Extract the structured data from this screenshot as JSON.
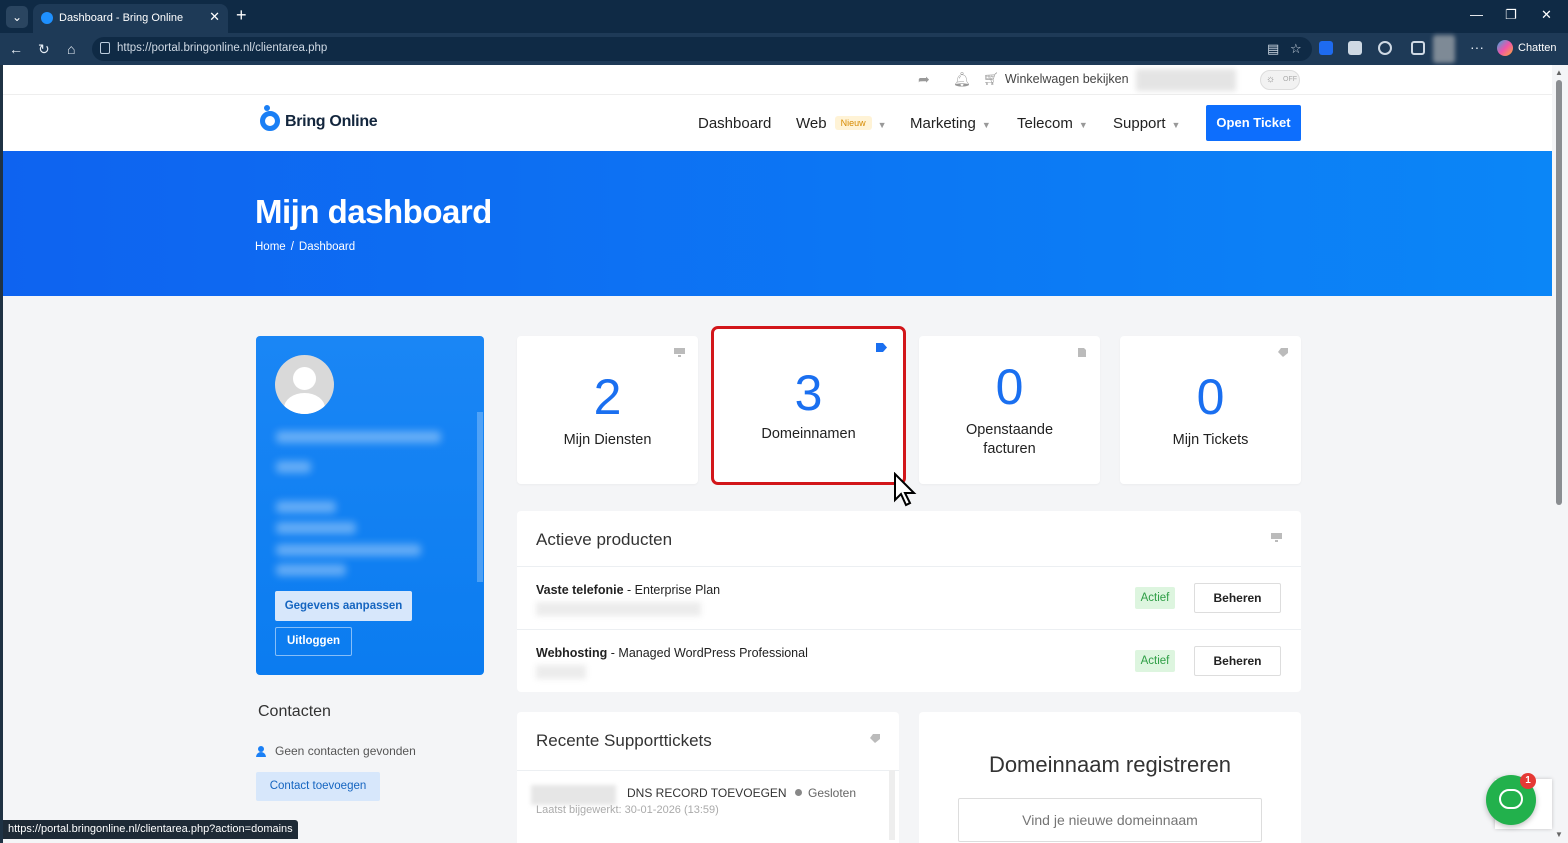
{
  "browser": {
    "tab_title": "Dashboard - Bring Online",
    "url": "https://portal.bringonline.nl/clientarea.php",
    "copilot_label": "Chatten",
    "status_url": "https://portal.bringonline.nl/clientarea.php?action=domains"
  },
  "topbar": {
    "cart_label": "Winkelwagen bekijken",
    "toggle_label": "OFF"
  },
  "nav": {
    "logo": "Bring Online",
    "items": [
      {
        "label": "Dashboard"
      },
      {
        "label": "Web",
        "badge": "Nieuw"
      },
      {
        "label": "Marketing"
      },
      {
        "label": "Telecom"
      },
      {
        "label": "Support"
      }
    ],
    "cta": "Open Ticket"
  },
  "hero": {
    "title": "Mijn dashboard",
    "breadcrumb": [
      "Home",
      "Dashboard"
    ]
  },
  "profile": {
    "edit_button": "Gegevens aanpassen",
    "logout_button": "Uitloggen"
  },
  "contacts": {
    "title": "Contacten",
    "empty_text": "Geen contacten gevonden",
    "add_button": "Contact toevoegen"
  },
  "stats": [
    {
      "value": "2",
      "label": "Mijn Diensten",
      "icon": "monitor-icon"
    },
    {
      "value": "3",
      "label": "Domeinnamen",
      "icon": "tag-icon"
    },
    {
      "value": "0",
      "label": "Openstaande facturen",
      "icon": "document-icon"
    },
    {
      "value": "0",
      "label": "Mijn Tickets",
      "icon": "ticket-icon"
    }
  ],
  "products": {
    "title": "Actieve producten",
    "rows": [
      {
        "name": "Vaste telefonie",
        "plan": "Enterprise Plan",
        "status": "Actief",
        "action": "Beheren"
      },
      {
        "name": "Webhosting",
        "plan": "Managed WordPress Professional",
        "status": "Actief",
        "action": "Beheren"
      }
    ]
  },
  "tickets": {
    "title": "Recente Supporttickets",
    "rows": [
      {
        "subject": "DNS RECORD TOEVOEGEN",
        "status": "Gesloten",
        "updated": "Laatst bijgewerkt: 30-01-2026 (13:59)"
      }
    ]
  },
  "domain": {
    "title": "Domeinnaam registreren",
    "placeholder": "Vind je nieuwe domeinnaam"
  },
  "chat": {
    "unread": "1"
  },
  "colors": {
    "primary": "#0d6efd",
    "highlight": "#d2161a",
    "success": "#2e9e45"
  }
}
